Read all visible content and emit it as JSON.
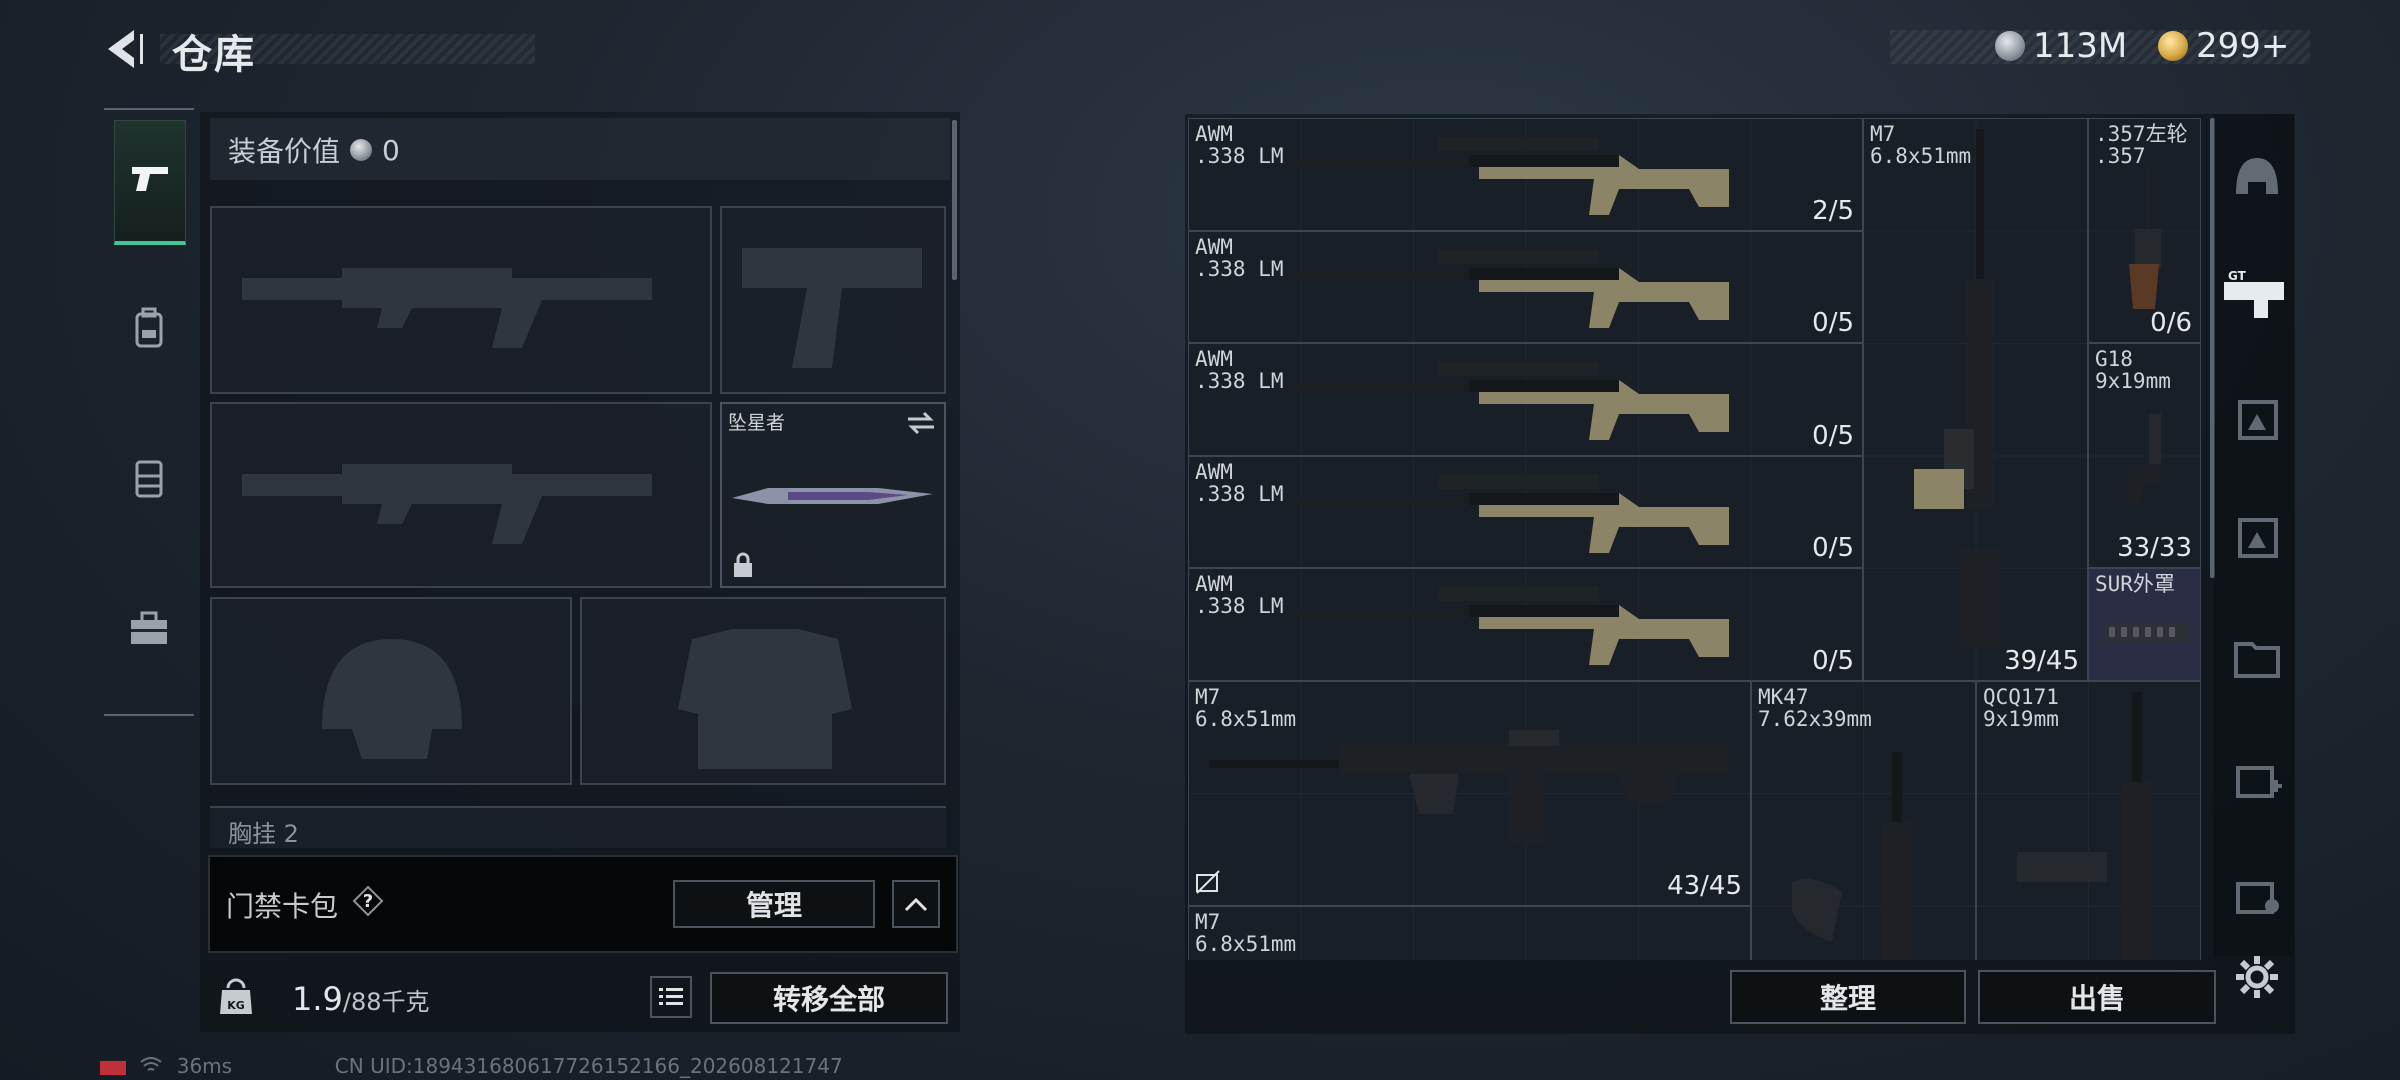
{
  "header": {
    "title": "仓库",
    "currencies": [
      {
        "icon": "silver-coin-icon",
        "value": "113M"
      },
      {
        "icon": "gold-coin-icon",
        "value": "299+"
      }
    ]
  },
  "left_rail": {
    "tabs": [
      {
        "icon": "pistol-icon",
        "active": true
      },
      {
        "icon": "backpack-icon",
        "active": false
      },
      {
        "icon": "vest-icon",
        "active": false
      },
      {
        "icon": "toolbox-icon",
        "active": false
      }
    ]
  },
  "loadout": {
    "equip_value_label": "装备价值",
    "equip_value": "0",
    "melee_name": "坠星者",
    "chest_label": "胸挂",
    "chest_count": "2",
    "keycard_label": "门禁卡包",
    "manage_label": "管理",
    "weight_value": "1.9",
    "weight_max": "/88千克",
    "kg_icon_label": "KG",
    "transfer_label": "转移全部"
  },
  "status": {
    "ping": "36ms",
    "uid": "CN UID:18943168061772615216​6_202608121747"
  },
  "stash": {
    "items": [
      {
        "name": "AWM\n.338 LM",
        "count": "2/5"
      },
      {
        "name": "AWM\n.338 LM",
        "count": "0/5"
      },
      {
        "name": "AWM\n.338 LM",
        "count": "0/5"
      },
      {
        "name": "AWM\n.338 LM",
        "count": "0/5"
      },
      {
        "name": "AWM\n.338 LM",
        "count": "0/5"
      },
      {
        "name": "M7\n6.8x51mm",
        "count": "39/45"
      },
      {
        "name": ".357左轮\n.357",
        "count": "0/6"
      },
      {
        "name": "G18\n9x19mm",
        "count": "33/33"
      },
      {
        "name": "SUR外罩",
        "count": ""
      },
      {
        "name": "M7\n6.8x51mm",
        "count": "43/45"
      },
      {
        "name": "MK47\n7.62x39mm",
        "count": ""
      },
      {
        "name": "QCQ171\n9x19mm",
        "count": ""
      },
      {
        "name": "M7\n6.8x51mm",
        "count": ""
      }
    ],
    "sort_label": "整理",
    "sell_label": "出售"
  },
  "colors": {
    "accent_green": "#3fc79a",
    "panel_dark": "#1b2128"
  }
}
